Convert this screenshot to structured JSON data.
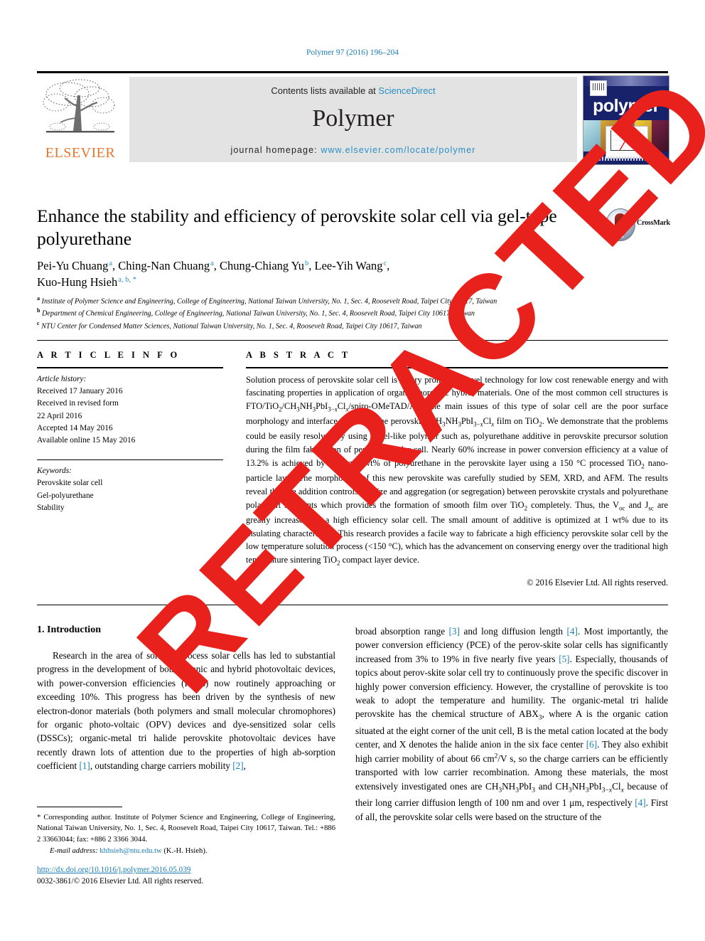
{
  "running_head": "Polymer 97 (2016) 196–204",
  "banner": {
    "publisher_name": "ELSEVIER",
    "contents_prefix": "Contents lists available at ",
    "contents_link": "ScienceDirect",
    "journal_title": "Polymer",
    "homepage_prefix": "journal homepage: ",
    "homepage_url": "www.elsevier.com/locate/polymer",
    "cover_word": "polymer"
  },
  "article": {
    "title": "Enhance the stability and efficiency of perovskite solar cell via gel-type polyurethane",
    "crossmark_label": "CrossMark",
    "authors_line1": "Pei-Yu Chuang ᵃ, Ching-Nan Chuang ᵃ, Chung-Chiang Yu ᵇ, Lee-Yih Wang ᶜ,",
    "authors_line2": "Kuo-Hung Hsieh ᵃ, ᵇ, *",
    "authors": [
      {
        "name": "Pei-Yu Chuang",
        "marks": "a"
      },
      {
        "name": "Ching-Nan Chuang",
        "marks": "a"
      },
      {
        "name": "Chung-Chiang Yu",
        "marks": "b"
      },
      {
        "name": "Lee-Yih Wang",
        "marks": "c"
      },
      {
        "name": "Kuo-Hung Hsieh",
        "marks": "a, b, *"
      }
    ],
    "affiliations": [
      {
        "mark": "a",
        "text": "Institute of Polymer Science and Engineering, College of Engineering, National Taiwan University, No. 1, Sec. 4, Roosevelt Road, Taipei City 10617, Taiwan"
      },
      {
        "mark": "b",
        "text": "Department of Chemical Engineering, College of Engineering, National Taiwan University, No. 1, Sec. 4, Roosevelt Road, Taipei City 10617, Taiwan"
      },
      {
        "mark": "c",
        "text": "NTU Center for Condensed Matter Sciences, National Taiwan University, No. 1, Sec. 4, Roosevelt Road, Taipei City 10617, Taiwan"
      }
    ]
  },
  "article_info": {
    "heading": "A R T I C L E   I N F O",
    "history_label": "Article history:",
    "history": [
      "Received 17 January 2016",
      "Received in revised form",
      "22 April 2016",
      "Accepted 14 May 2016",
      "Available online 15 May 2016"
    ],
    "keywords_label": "Keywords:",
    "keywords": [
      "Perovskite solar cell",
      "Gel-polyurethane",
      "Stability"
    ]
  },
  "abstract": {
    "heading": "A B S T R A C T",
    "part1": "Solution process of perovskite solar cell is a very promising novel technology for low cost renewable energy and with fascinating properties in application of organic/inorganic hybrid materials. One of the most common cell structures is FTO/TiO",
    "part2": "/CH",
    "part3": "NH",
    "part4": "PbI",
    "part5": "Cl",
    "part6": "/spiro-OMeTAD/Au. The main issues of this type of solar cell are the poor surface morphology and interface control of the perovskite CH",
    "part7": "NH",
    "part8": "PbI",
    "part9": "Cl",
    "part10": " film on TiO",
    "part11": ". We demonstrate that the problems could be easily resolved by using a Gel-like polymer such as, polyurethane additive in perovskite precursor solution during the film fabrication of perovskite solar cell. Nearly 60% increase in power conversion efficiency at a value of 13.2% is achieved by adding 1 wt% of polyurethane in the perovskite layer using a 150 °C processed TiO",
    "part12": " nano-particle layer. The morphology of this new perovskite was carefully studied by SEM, XRD, and AFM. The results reveal that the addition controls the size and aggregation (or segregation) between perovskite crystals and polyurethane polar soft segments which provides the formation of smooth film over TiO",
    "part13": " completely. Thus, the V",
    "part14": " and J",
    "part15": " are greatly increased for a high efficiency solar cell. The small amount of additive is optimized at 1 wt% due to its insulating characteristics. This research provides a facile way to fabricate a high efficiency perovskite solar cell by the low temperature solution process (<150 °C), which has the advancement on conserving energy over the traditional high temperature sintering TiO",
    "part16": " compact layer device.",
    "copyright": "© 2016 Elsevier Ltd. All rights reserved."
  },
  "introduction": {
    "heading": "1. Introduction",
    "left_paragraph_a": "Research in the area of solution-process solar cells has led to substantial progress in the development of both organic and hybrid photovoltaic devices, with power-conversion efficiencies (PCEs) now routinely approaching or exceeding 10%. This progress has been driven by the synthesis of new electron-donor materials (both polymers and small molecular chromophores) for organic photo-voltaic (OPV) devices and dye-sensitized solar cells (DSSCs); organic-metal tri halide perovskite photovoltaic devices have recently drawn lots of attention due to the properties of high ab-sorption coefficient ",
    "left_ref_1": "[1]",
    "left_paragraph_b": ", outstanding charge carriers mobility ",
    "left_ref_2": "[2]",
    "left_paragraph_c": ",",
    "right_a": "broad absorption range ",
    "right_ref_3": "[3]",
    "right_b": " and long diffusion length ",
    "right_ref_4": "[4]",
    "right_c": ". Most importantly, the power conversion efficiency (PCE) of the perov-skite solar cells has significantly increased from 3% to 19% in five nearly five years ",
    "right_ref_5": "[5]",
    "right_d": ". Especially, thousands of topics about perov-skite solar cell try to continuously prove the specific discover in highly power conversion efficiency. However, the crystalline of perovskite is too weak to adopt the temperature and humility. The organic-metal tri halide perovskite has the chemical structure of ABX",
    "right_e": ", where A is the organic cation situated at the eight corner of the unit cell, B is the metal cation located at the body center, and X denotes the halide anion in the six face center ",
    "right_ref_6": "[6]",
    "right_f": ". They also exhibit high carrier mobility of about 66 cm",
    "right_g": "/V s, so the charge carriers can be efficiently transported with low carrier recombination. Among these materials, the most extensively investigated ones are CH",
    "right_h": "NH",
    "right_i": "PbI",
    "right_j": " and CH",
    "right_k": "NH",
    "right_l": "PbI",
    "right_m": "Cl",
    "right_n": " because of their long carrier diffusion length of 100 nm and over 1 μm, respectively ",
    "right_ref_4b": "[4]",
    "right_o": ". First of all, the perovskite solar cells were based on the structure of the"
  },
  "footer": {
    "corresponding_marker": "*",
    "corresponding_text": " Corresponding author. Institute of Polymer Science and Engineering, College of Engineering, National Taiwan University, No. 1, Sec. 4, Roosevelt Road, Taipei City 10617, Taiwan. Tel.: +886 2 33663044; fax: +886 2 3366 3044.",
    "email_label": "E-mail address:",
    "email": "khhsieh@ntu.edu.tw",
    "email_suffix": " (K.-H. Hsieh).",
    "doi_url": "http://dx.doi.org/10.1016/j.polymer.2016.05.039",
    "issn_line": "0032-3861/© 2016 Elsevier Ltd. All rights reserved."
  },
  "watermark": {
    "text": "RETRACTED",
    "color": "#e8211c"
  },
  "colors": {
    "link": "#1a7eb5",
    "sciencedirect": "#2a8fc4",
    "elsevier_orange": "#e8762d",
    "banner_gray": "#e3e3e3",
    "cover_blue": "#17226b"
  }
}
